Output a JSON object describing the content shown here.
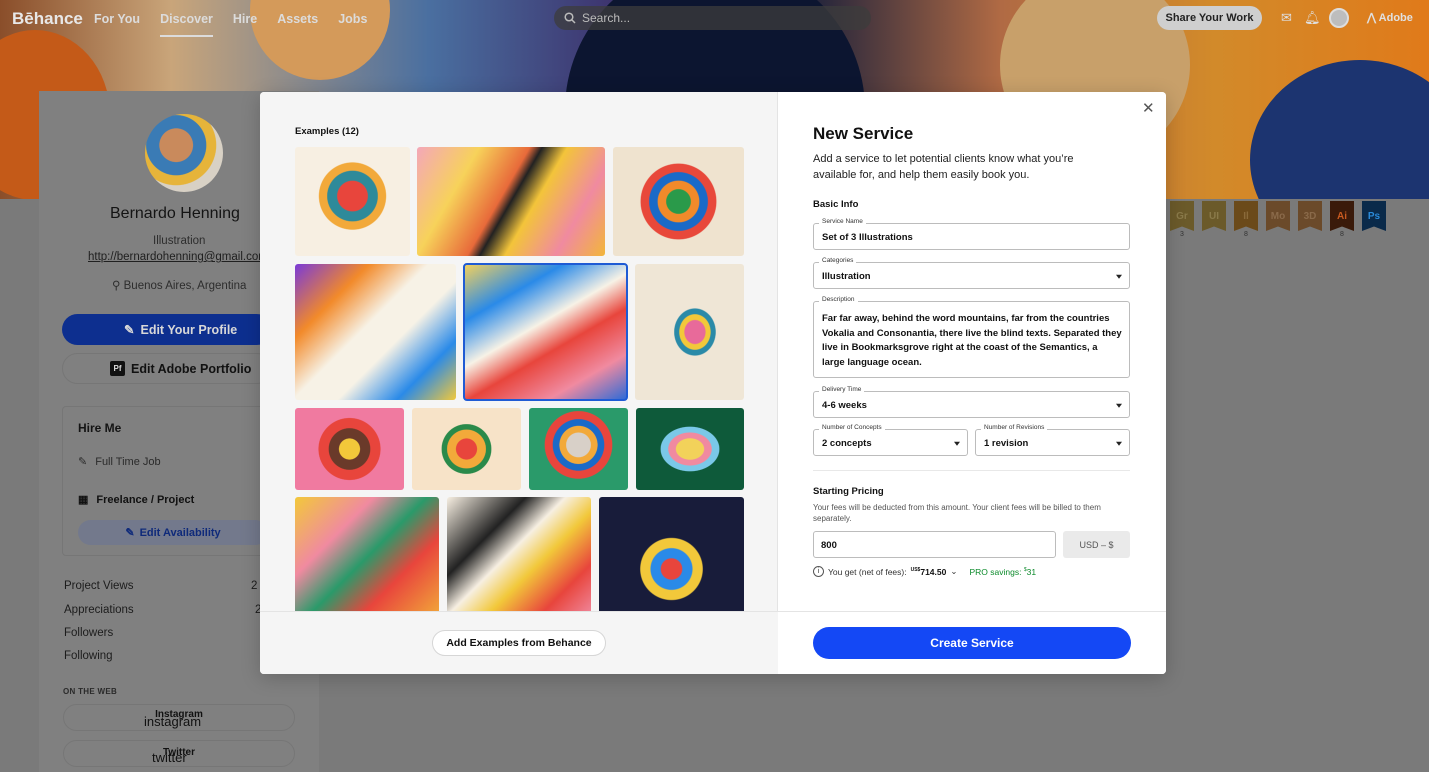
{
  "nav": {
    "logo": "Bēhance",
    "links": [
      "For You",
      "Discover",
      "Hire",
      "Assets",
      "Jobs"
    ],
    "search_placeholder": "Search...",
    "share_label": "Share Your Work",
    "adobe_label": "Adobe"
  },
  "profile": {
    "name": "Bernardo Henning",
    "field": "Illustration",
    "email": "http://bernardohenning@gmail.com",
    "location": "Buenos Aires, Argentina",
    "edit_profile_label": "Edit Your Profile",
    "edit_portfolio_label": "Edit Adobe Portfolio",
    "pf_badge": "Pf"
  },
  "hire": {
    "title": "Hire Me",
    "items": [
      "Full Time Job",
      "Freelance / Project"
    ],
    "edit_availability": "Edit Availability"
  },
  "stats": [
    {
      "label": "Project Views",
      "value": "2"
    },
    {
      "label": "Appreciations",
      "value": "2"
    },
    {
      "label": "Followers",
      "value": ""
    },
    {
      "label": "Following",
      "value": ""
    }
  ],
  "on_the_web": {
    "heading": "ON THE WEB",
    "links": [
      {
        "icon": "instagram",
        "label": "Instagram"
      },
      {
        "icon": "twitter",
        "label": "Twitter"
      }
    ]
  },
  "tools": [
    {
      "abbr": "Gr",
      "count": "3",
      "color": "#6b5a2a",
      "text": "#8a7a4a"
    },
    {
      "abbr": "UI",
      "count": "",
      "color": "#6b5a2a",
      "text": "#8a7a4a"
    },
    {
      "abbr": "Il",
      "count": "8",
      "color": "#6b4a1a",
      "text": "#8a6a3a"
    },
    {
      "abbr": "Mo",
      "count": "",
      "color": "#6b4a2a",
      "text": "#8a6a4a"
    },
    {
      "abbr": "3D",
      "count": "",
      "color": "#6b4a2a",
      "text": "#8a6a4a"
    },
    {
      "abbr": "Ai",
      "count": "8",
      "color": "#3a1a0a",
      "text": "#c85a20"
    },
    {
      "abbr": "Ps",
      "count": "",
      "color": "#0a2a4a",
      "text": "#2a8ad8"
    }
  ],
  "modal": {
    "examples_title": "Examples (12)",
    "add_examples_label": "Add Examples from Behance",
    "title": "New Service",
    "subtitle": "Add a service to let potential clients know what you’re available for, and help them easily book you.",
    "basic_info": "Basic Info",
    "service_name": {
      "label": "Service Name",
      "value": "Set of 3 Illustrations"
    },
    "categories": {
      "label": "Categories",
      "value": "Illustration"
    },
    "description": {
      "label": "Description",
      "value": "Far far away, behind the word mountains, far from the countries Vokalia and Consonantia, there live the blind texts. Separated they live in Bookmarksgrove right at the coast of the Semantics, a large language ocean."
    },
    "delivery_time": {
      "label": "Delivery Time",
      "value": "4-6 weeks"
    },
    "concepts": {
      "label": "Number of Concepts",
      "value": "2 concepts"
    },
    "revisions": {
      "label": "Number of Revisions",
      "value": "1 revision"
    },
    "starting_pricing": "Starting Pricing",
    "fees_note": "Your fees will be deducted from this amount. Your client fees will be billed to them separately.",
    "price": "800",
    "currency": "USD – $",
    "you_get_label": "You get (net of fees):",
    "you_get_currency": "US$",
    "you_get_value": "714.50",
    "pro_savings_label": "PRO savings:",
    "pro_savings_currency": "$",
    "pro_savings_value": "31",
    "create_label": "Create Service"
  }
}
